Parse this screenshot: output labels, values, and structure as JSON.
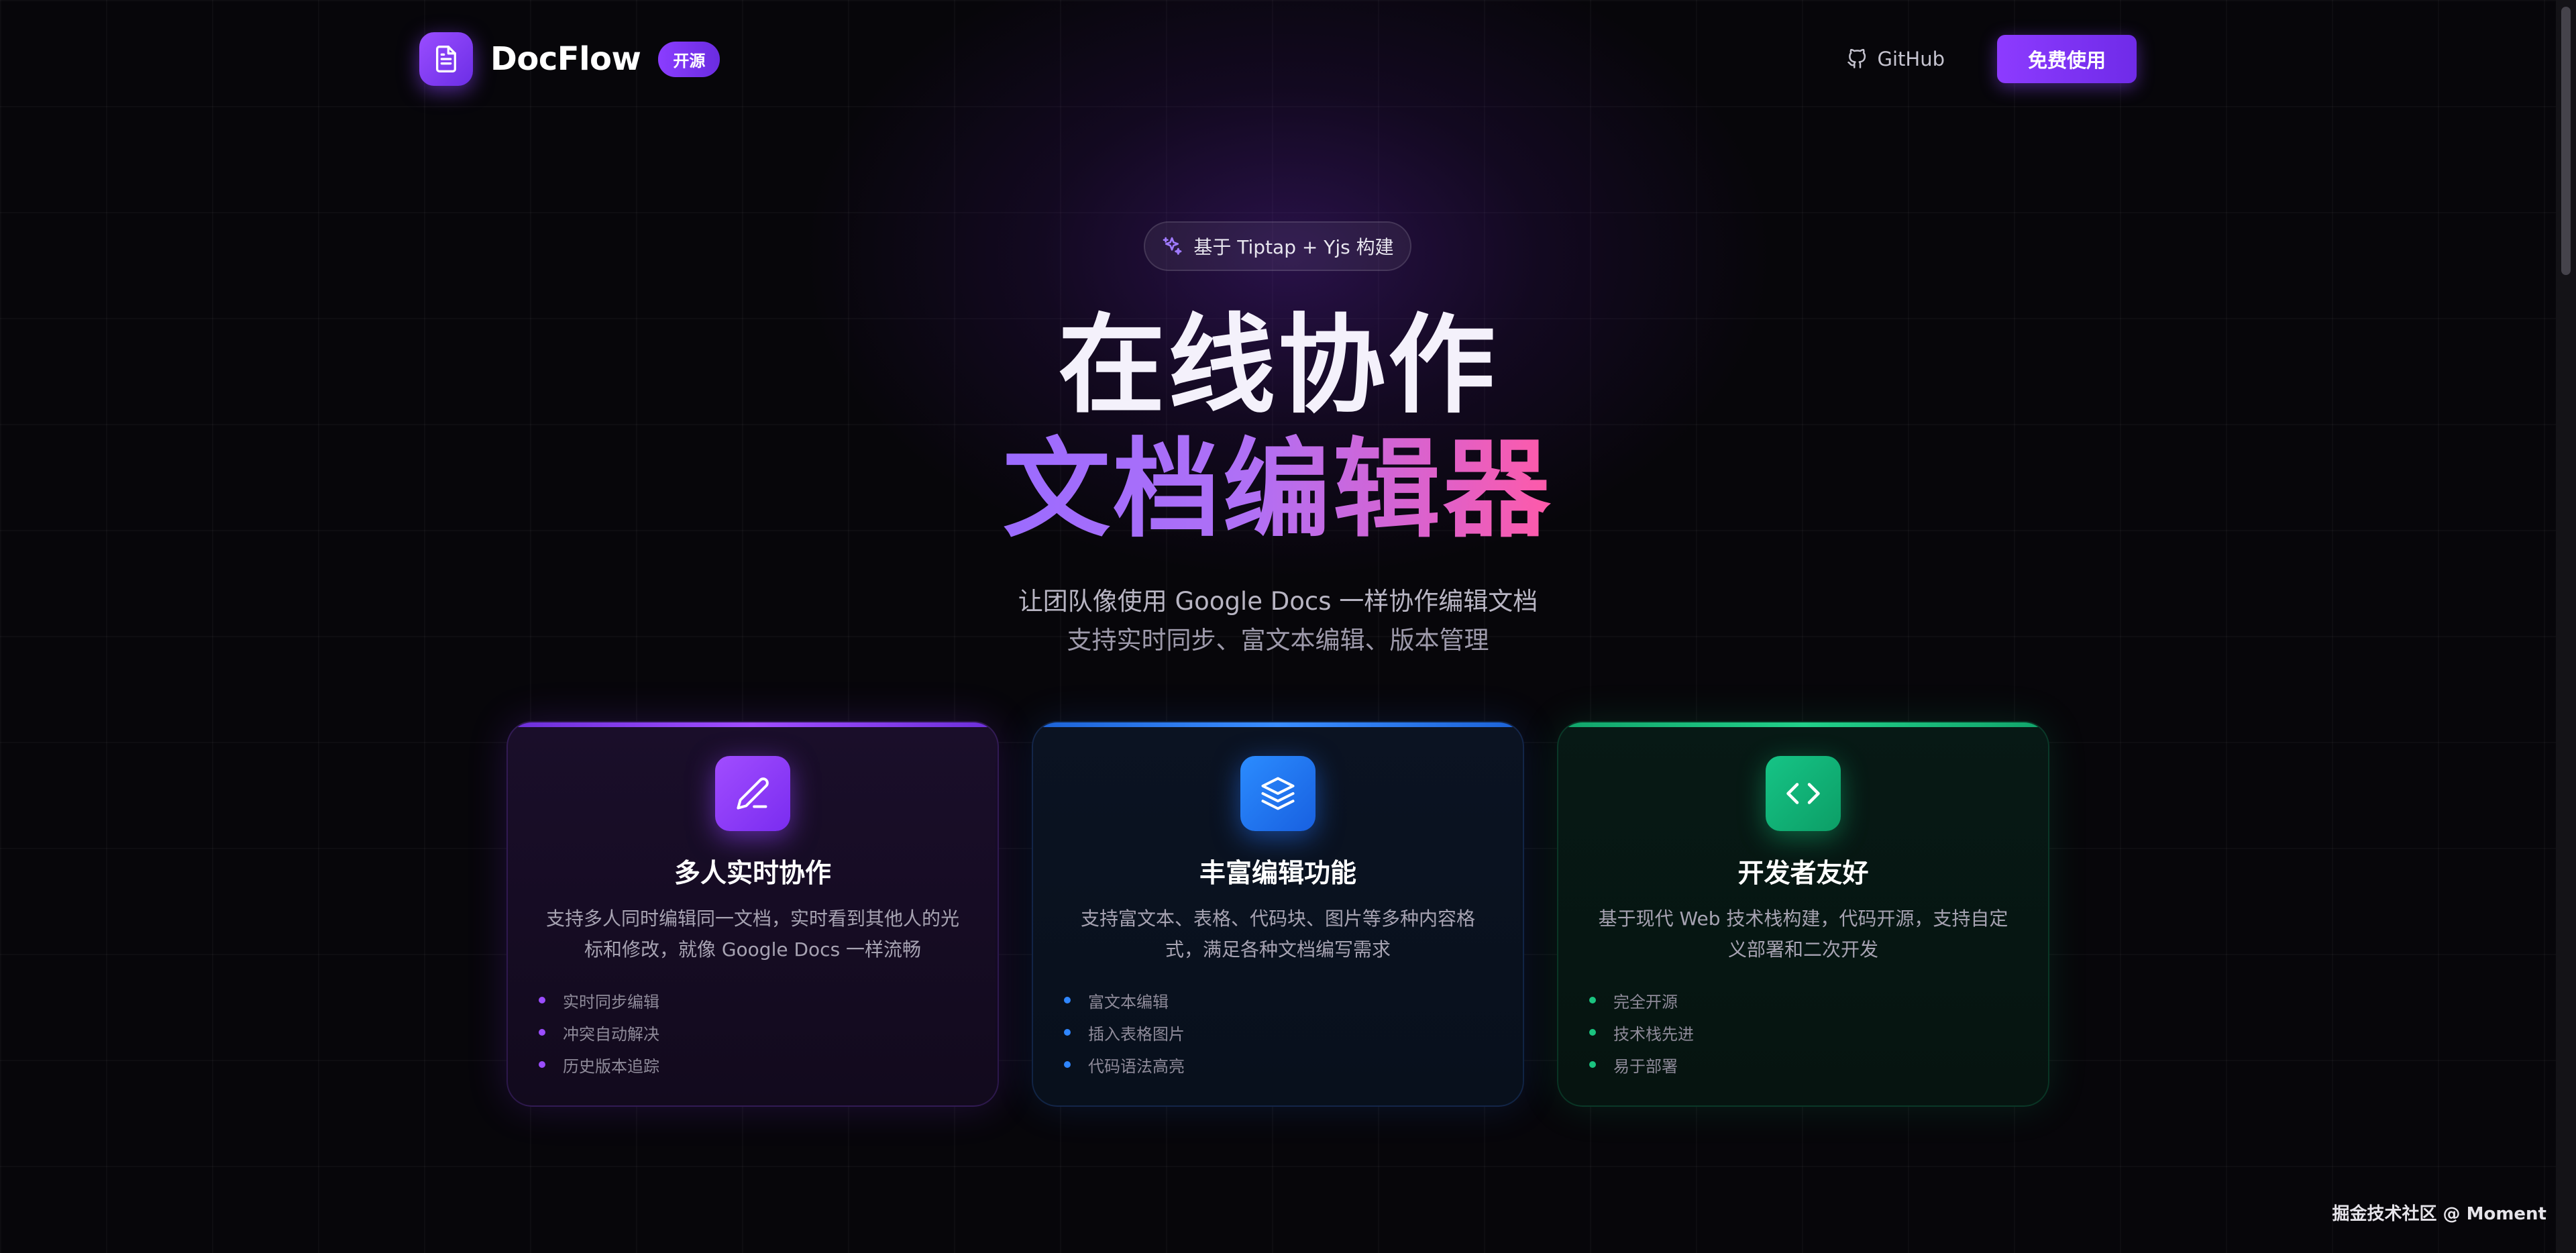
{
  "nav": {
    "brand": "DocFlow",
    "badge": "开源",
    "github_label": "GitHub",
    "cta_label": "免费使用"
  },
  "hero": {
    "pill_text": "基于 Tiptap + Yjs 构建",
    "title_line1": "在线协作",
    "title_line2": "文档编辑器",
    "subtitle_line1": "让团队像使用 Google Docs 一样协作编辑文档",
    "subtitle_line2": "支持实时同步、富文本编辑、版本管理"
  },
  "features": [
    {
      "icon": "pen-icon",
      "title": "多人实时协作",
      "desc": "支持多人同时编辑同一文档，实时看到其他人的光标和修改，就像 Google Docs 一样流畅",
      "points": [
        "实时同步编辑",
        "冲突自动解决",
        "历史版本追踪"
      ],
      "accent": "#9b4dff"
    },
    {
      "icon": "layers-icon",
      "title": "丰富编辑功能",
      "desc": "支持富文本、表格、代码块、图片等多种内容格式，满足各种文档编写需求",
      "points": [
        "富文本编辑",
        "插入表格图片",
        "代码语法高亮"
      ],
      "accent": "#2f86ff"
    },
    {
      "icon": "code-icon",
      "title": "开发者友好",
      "desc": "基于现代 Web 技术栈构建，代码开源，支持自定义部署和二次开发",
      "points": [
        "完全开源",
        "技术栈先进",
        "易于部署"
      ],
      "accent": "#1bc480"
    }
  ],
  "watermark": "掘金技术社区 @ Moment"
}
